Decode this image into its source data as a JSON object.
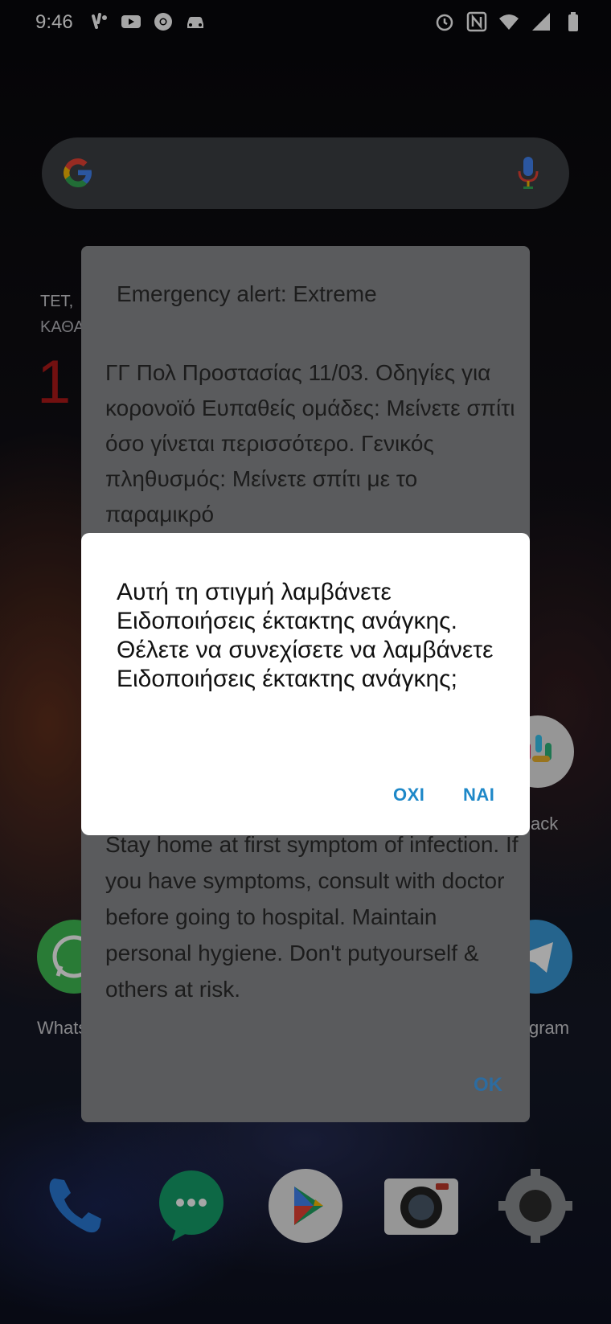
{
  "status_bar": {
    "time": "9:46"
  },
  "home": {
    "date_line": "ΤΕΤ,",
    "date_sub": "ΚΑΘΑ",
    "red_digit": "1",
    "side_labels": {
      "whatsapp": "Whats",
      "slack": "ack",
      "telegram": "gram"
    }
  },
  "alert": {
    "title": "Emergency alert: Extreme",
    "body_greek": "ΓΓ Πολ Προστασίας 11/03. Οδηγίες για κορονοϊό Ευπαθείς ομάδες: Μείνετε σπίτι όσο γίνεται περισσότερο. Γενικός πληθυσμός: Μείνετε σπίτι με το παραμικρό",
    "body_english": "Stay home at first symptom of infection. If you have symptoms, consult with doctor before going to hospital. Maintain personal hygiene. Don't putyourself & others at risk.",
    "ok_label": "OK"
  },
  "confirm_dialog": {
    "message": "Αυτή τη στιγμή λαμβάνετε Ειδοποιήσεις έκτακτης ανάγκης. Θέλετε να συνεχίσετε να λαμβάνετε Ειδοποιήσεις έκτακτης ανάγκης;",
    "no_label": "ΟΧΙ",
    "yes_label": "ΝΑΙ"
  },
  "colors": {
    "dialog_button": "#1e88c8",
    "alert_ok": "#2d6ca0"
  }
}
